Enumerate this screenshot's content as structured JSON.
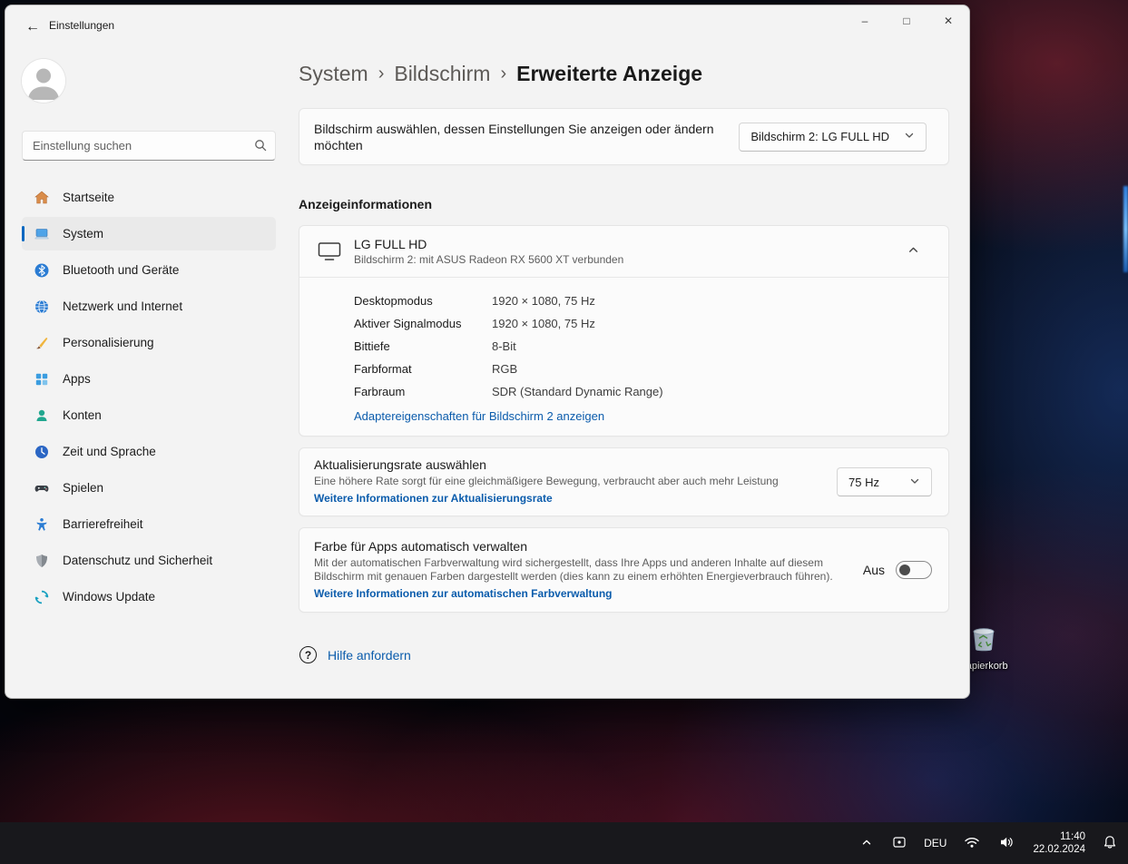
{
  "window": {
    "title": "Einstellungen",
    "back_glyph": "←",
    "controls": {
      "minimize": "–",
      "maximize": "□",
      "close": "✕"
    }
  },
  "sidebar": {
    "search_placeholder": "Einstellung suchen",
    "items": [
      {
        "label": "Startseite"
      },
      {
        "label": "System"
      },
      {
        "label": "Bluetooth und Geräte"
      },
      {
        "label": "Netzwerk und Internet"
      },
      {
        "label": "Personalisierung"
      },
      {
        "label": "Apps"
      },
      {
        "label": "Konten"
      },
      {
        "label": "Zeit und Sprache"
      },
      {
        "label": "Spielen"
      },
      {
        "label": "Barrierefreiheit"
      },
      {
        "label": "Datenschutz und Sicherheit"
      },
      {
        "label": "Windows Update"
      }
    ]
  },
  "breadcrumb": {
    "separator": "›",
    "items": [
      "System",
      "Bildschirm",
      "Erweiterte Anzeige"
    ]
  },
  "display_select": {
    "label": "Bildschirm auswählen, dessen Einstellungen Sie anzeigen oder ändern möchten",
    "value": "Bildschirm 2: LG FULL HD"
  },
  "sections": {
    "info_title": "Anzeigeinformationen"
  },
  "display_info": {
    "name": "LG FULL HD",
    "subtitle": "Bildschirm 2: mit ASUS Radeon RX 5600 XT verbunden",
    "rows": [
      {
        "label": "Desktopmodus",
        "value": "1920 × 1080, 75 Hz"
      },
      {
        "label": "Aktiver Signalmodus",
        "value": "1920 × 1080, 75 Hz"
      },
      {
        "label": "Bittiefe",
        "value": "8-Bit"
      },
      {
        "label": "Farbformat",
        "value": "RGB"
      },
      {
        "label": "Farbraum",
        "value": "SDR (Standard Dynamic Range)"
      }
    ],
    "adapter_link": "Adaptereigenschaften für Bildschirm 2 anzeigen"
  },
  "refresh": {
    "title": "Aktualisierungsrate auswählen",
    "description": "Eine höhere Rate sorgt für eine gleichmäßigere Bewegung, verbraucht aber auch mehr Leistung",
    "link": "Weitere Informationen zur Aktualisierungsrate",
    "value": "75 Hz"
  },
  "color": {
    "title": "Farbe für Apps automatisch verwalten",
    "description": "Mit der automatischen Farbverwaltung wird sichergestellt, dass Ihre Apps und anderen Inhalte auf diesem Bildschirm mit genauen Farben dargestellt werden (dies kann zu einem erhöhten Energieverbrauch führen).",
    "link": "Weitere Informationen zur automatischen Farbverwaltung",
    "state": "Aus"
  },
  "help": {
    "label": "Hilfe anfordern",
    "icon_glyph": "?"
  },
  "desktop": {
    "recycle_bin_label": "Papierkorb"
  },
  "taskbar": {
    "language": "DEU",
    "time": "11:40",
    "date": "22.02.2024"
  }
}
